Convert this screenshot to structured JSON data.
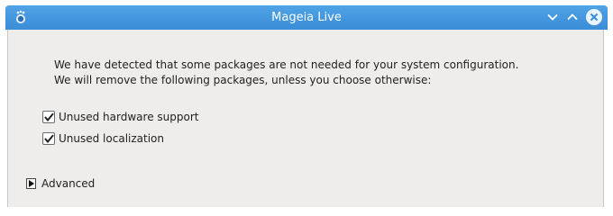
{
  "window": {
    "title": "Mageia Live",
    "accent_color": "#3a8dd6",
    "icons": {
      "app": "mageia-logo-icon",
      "minimize": "minimize-icon",
      "maximize": "maximize-icon",
      "close": "close-icon"
    }
  },
  "dialog": {
    "message_line1": "We have detected that some packages are not needed for your system configuration.",
    "message_line2": "We will remove the following packages, unless you choose otherwise:",
    "options": [
      {
        "label": "Unused hardware support",
        "checked": true
      },
      {
        "label": "Unused localization",
        "checked": true
      }
    ],
    "advanced_label": "Advanced",
    "advanced_expanded": false
  }
}
